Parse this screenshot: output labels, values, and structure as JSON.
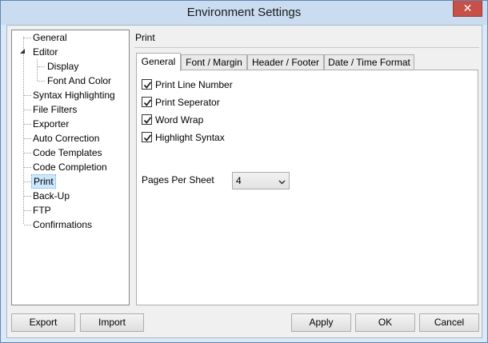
{
  "window": {
    "title": "Environment Settings",
    "close_glyph": "✕"
  },
  "tree": {
    "items": [
      {
        "label": "General"
      },
      {
        "label": "Editor",
        "expanded": true
      },
      {
        "label": "Display"
      },
      {
        "label": "Font And Color"
      },
      {
        "label": "Syntax Highlighting"
      },
      {
        "label": "File Filters"
      },
      {
        "label": "Exporter"
      },
      {
        "label": "Auto Correction"
      },
      {
        "label": "Code Templates"
      },
      {
        "label": "Code Completion"
      },
      {
        "label": "Print",
        "selected": true
      },
      {
        "label": "Back-Up"
      },
      {
        "label": "FTP"
      },
      {
        "label": "Confirmations"
      }
    ]
  },
  "panel": {
    "title": "Print",
    "tabs": [
      {
        "label": "General",
        "active": true
      },
      {
        "label": "Font / Margin"
      },
      {
        "label": "Header / Footer"
      },
      {
        "label": "Date / Time Format"
      }
    ],
    "options": [
      {
        "label": "Print Line Number",
        "checked": true
      },
      {
        "label": "Print Seperator",
        "checked": true
      },
      {
        "label": "Word Wrap",
        "checked": true
      },
      {
        "label": "Highlight Syntax",
        "checked": true
      }
    ],
    "pages_per_sheet": {
      "label": "Pages Per Sheet",
      "value": "4"
    }
  },
  "buttons": {
    "export": "Export",
    "import": "Import",
    "apply": "Apply",
    "ok": "OK",
    "cancel": "Cancel"
  },
  "colors": {
    "titlebar": "#c9dcf0",
    "close": "#c7504a",
    "selection": "#cce8ff"
  }
}
